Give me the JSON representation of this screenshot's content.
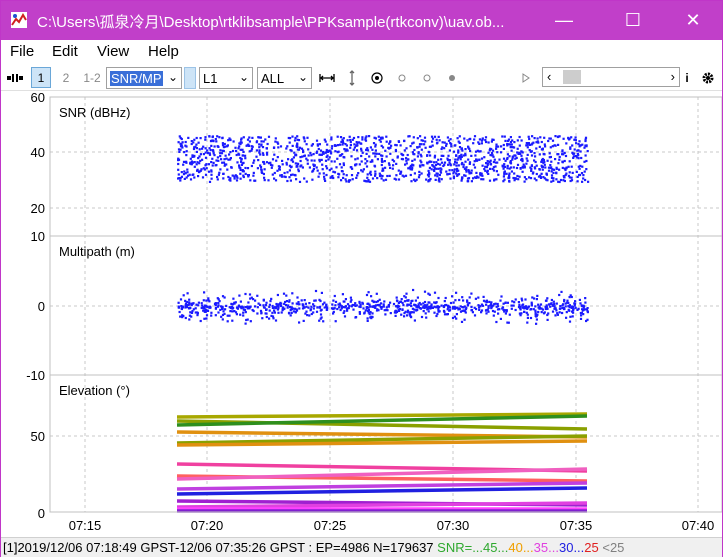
{
  "window": {
    "title": "C:\\Users\\孤泉冷月\\Desktop\\rtklibsample\\PPKsample(rtkconv)\\uav.ob...",
    "controls": {
      "minimize": "—",
      "maximize": "☐",
      "close": "✕"
    }
  },
  "menu": [
    "File",
    "Edit",
    "View",
    "Help"
  ],
  "toolbar": {
    "frame1": "1",
    "frame2": "2",
    "frame12": "1-2",
    "plot_type": "SNR/MP",
    "frequency": "L1",
    "satellite": "ALL"
  },
  "plots": [
    {
      "title": "SNR (dBHz)",
      "ylabels": [
        "60",
        "40",
        "20"
      ]
    },
    {
      "title": "Multipath (m)",
      "ylabels": [
        "10",
        "0",
        "-10"
      ]
    },
    {
      "title": "Elevation (°)",
      "ylabels": [
        "50",
        "0"
      ]
    }
  ],
  "xaxis": [
    "07:15",
    "07:20",
    "07:25",
    "07:30",
    "07:35",
    "07:40"
  ],
  "status": {
    "prefix": "[1]2019/12/06 07:18:49 GPST-12/06 07:35:26 GPST : EP=4986 N=179637 ",
    "legend": [
      {
        "text": "SNR=...",
        "color": "#2ea82e"
      },
      {
        "text": "45",
        "color": "#2ea82e"
      },
      {
        "text": "...",
        "color": "#2ea82e"
      },
      {
        "text": "40",
        "color": "#f0a000"
      },
      {
        "text": "...",
        "color": "#f0a000"
      },
      {
        "text": "35",
        "color": "#e040e0"
      },
      {
        "text": "...",
        "color": "#e040e0"
      },
      {
        "text": "30",
        "color": "#2020e0"
      },
      {
        "text": "...",
        "color": "#2020e0"
      },
      {
        "text": "25",
        "color": "#e02020"
      },
      {
        "text": " <25",
        "color": "#808080"
      }
    ]
  },
  "colors": {
    "titlebar": "#c13fc9",
    "snr": "#1a1aff",
    "selected": "#3a6fd8"
  }
}
